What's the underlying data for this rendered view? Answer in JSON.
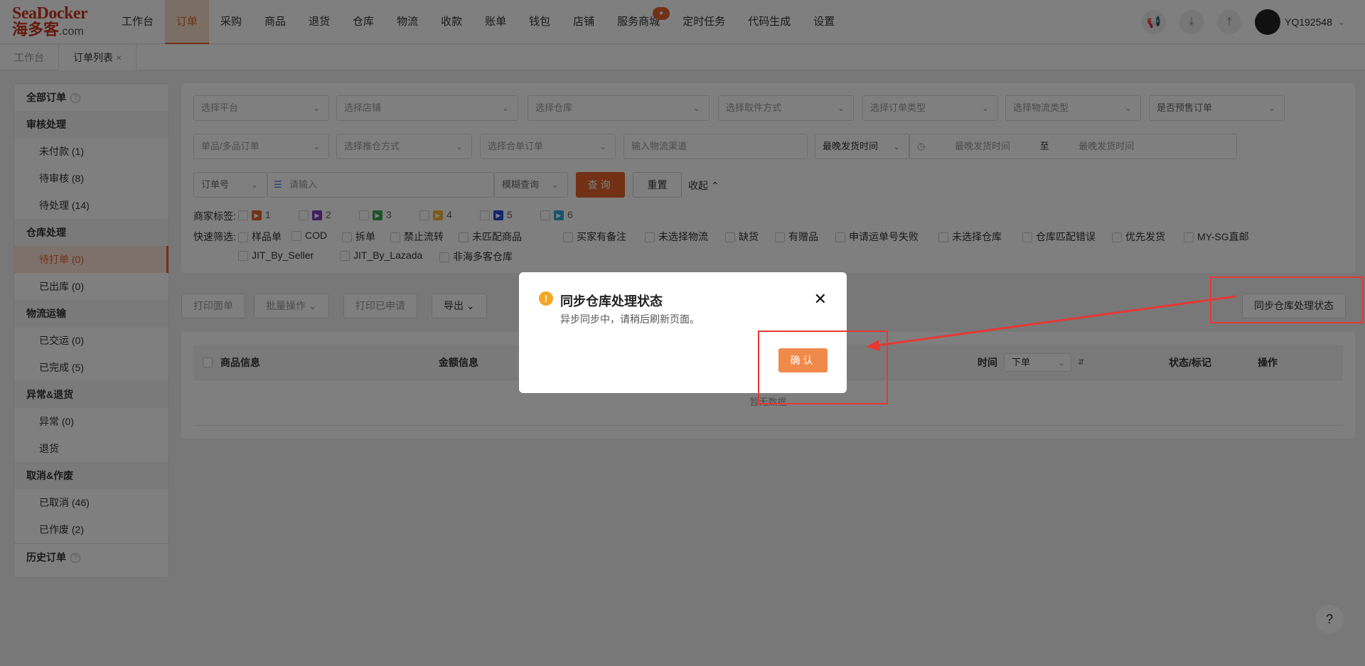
{
  "logo": {
    "line1": "SeaDocker",
    "line2": "海多客",
    "suffix": ".com"
  },
  "nav": {
    "items": [
      "工作台",
      "订单",
      "采购",
      "商品",
      "退货",
      "仓库",
      "物流",
      "收款",
      "账单",
      "钱包",
      "店铺",
      "服务商城",
      "定时任务",
      "代码生成",
      "设置"
    ],
    "active": "订单",
    "badge": "●"
  },
  "user": {
    "name": "YQ192548"
  },
  "tabs": [
    {
      "label": "工作台"
    },
    {
      "label": "订单列表",
      "close": "×"
    }
  ],
  "sidebar": {
    "items": [
      {
        "label": "全部订单",
        "type": "group-top",
        "help": "?"
      },
      {
        "label": "审核处理",
        "type": "group"
      },
      {
        "label": "未付款 (1)",
        "type": "sub"
      },
      {
        "label": "待审核 (8)",
        "type": "sub"
      },
      {
        "label": "待处理 (14)",
        "type": "sub"
      },
      {
        "label": "仓库处理",
        "type": "group"
      },
      {
        "label": "待打单 (0)",
        "type": "sub-active"
      },
      {
        "label": "已出库 (0)",
        "type": "sub"
      },
      {
        "label": "物流运输",
        "type": "group"
      },
      {
        "label": "已交运 (0)",
        "type": "sub"
      },
      {
        "label": "已完成 (5)",
        "type": "sub"
      },
      {
        "label": "异常&退货",
        "type": "group"
      },
      {
        "label": "异常 (0)",
        "type": "sub"
      },
      {
        "label": "退货",
        "type": "sub"
      },
      {
        "label": "取消&作废",
        "type": "group"
      },
      {
        "label": "已取消 (46)",
        "type": "sub"
      },
      {
        "label": "已作废 (2)",
        "type": "sub"
      },
      {
        "label": "历史订单",
        "type": "group-top",
        "help": "?"
      }
    ]
  },
  "filters": {
    "row1": [
      "选择平台",
      "选择店铺",
      "选择仓库",
      "选择取件方式",
      "选择订单类型",
      "选择物流类型",
      "是否预售订单"
    ],
    "row2": [
      "单品/多品订单",
      "选择推仓方式",
      "选择合单订单"
    ],
    "logistics_placeholder": "输入物流渠道",
    "time_type": "最晚发货时间",
    "time_start": "最晚发货时间",
    "time_sep": "至",
    "time_end": "最晚发货时间",
    "order_no_select": "订单号",
    "search_placeholder": "请输入",
    "match_mode": "模糊查询",
    "query_label": "查询",
    "reset_label": "重置",
    "collapse_label": "收起",
    "merchant_tags_label": "商家标签:",
    "merchant_tags": [
      {
        "label": "1",
        "color": "#e5622a"
      },
      {
        "label": "2",
        "color": "#7b3fc4"
      },
      {
        "label": "3",
        "color": "#3aa757"
      },
      {
        "label": "4",
        "color": "#f5b731"
      },
      {
        "label": "5",
        "color": "#1f4fd6"
      },
      {
        "label": "6",
        "color": "#2fa8d8"
      }
    ],
    "quick_label": "快速筛选:",
    "quick_row1": [
      "样品单",
      "COD",
      "拆单",
      "禁止流转",
      "未匹配商品",
      "买家有备注",
      "未选择物流",
      "缺货",
      "有赠品",
      "申请运单号失败",
      "未选择仓库",
      "仓库匹配错误",
      "优先发货",
      "MY-SG直邮"
    ],
    "quick_row2": [
      "JIT_By_Seller",
      "JIT_By_Lazada",
      "非海多客仓库"
    ]
  },
  "toolbar": {
    "print": "打印面单",
    "batch": "批量操作",
    "printed": "打印已申请",
    "export": "导出",
    "sync": "同步仓库处理状态"
  },
  "table": {
    "headers": {
      "product": "商品信息",
      "amount": "金额信息",
      "time": "时间",
      "status": "状态/标记",
      "action": "操作"
    },
    "time_select": "下单",
    "empty": "暂无数据"
  },
  "dialog": {
    "title": "同步仓库处理状态",
    "message": "异步同步中，请稍后刷新页面。",
    "close": "✕",
    "icon": "!",
    "ok": "确认"
  },
  "help": "?",
  "colors": {
    "accent": "#e5622a",
    "annotation": "#e53935"
  }
}
